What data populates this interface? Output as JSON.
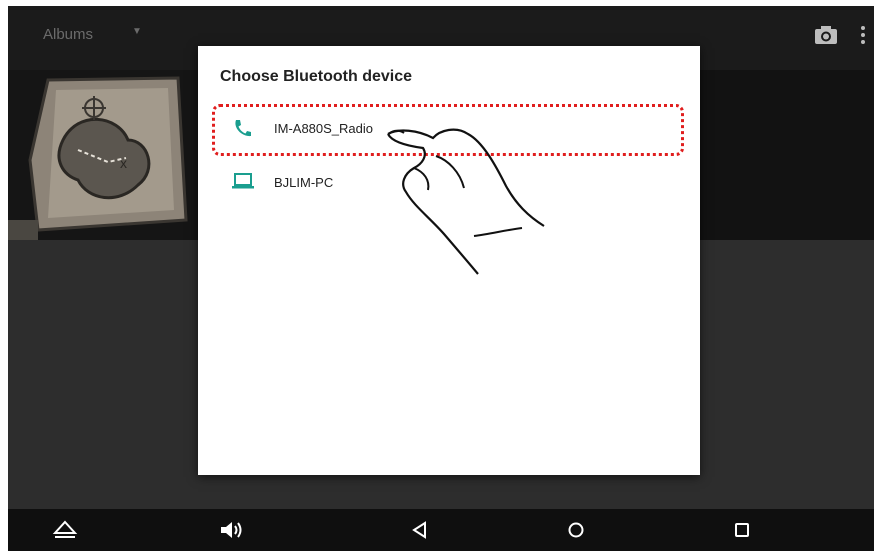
{
  "app_bar": {
    "title": "Albums",
    "dropdown_icon": "caret-down-icon",
    "actions": [
      "camera-icon",
      "overflow-menu-icon"
    ]
  },
  "dialog": {
    "title": "Choose Bluetooth device",
    "devices": [
      {
        "name": "IM-A880S_Radio",
        "icon": "phone-icon",
        "color": "#1a9e8f"
      },
      {
        "name": "BJLIM-PC",
        "icon": "laptop-icon",
        "color": "#1a9e8f"
      }
    ],
    "highlight_color": "#e01e1e"
  },
  "nav_bar": {
    "buttons": [
      "eject-icon",
      "volume-icon",
      "back-icon",
      "home-icon",
      "recents-icon"
    ]
  }
}
